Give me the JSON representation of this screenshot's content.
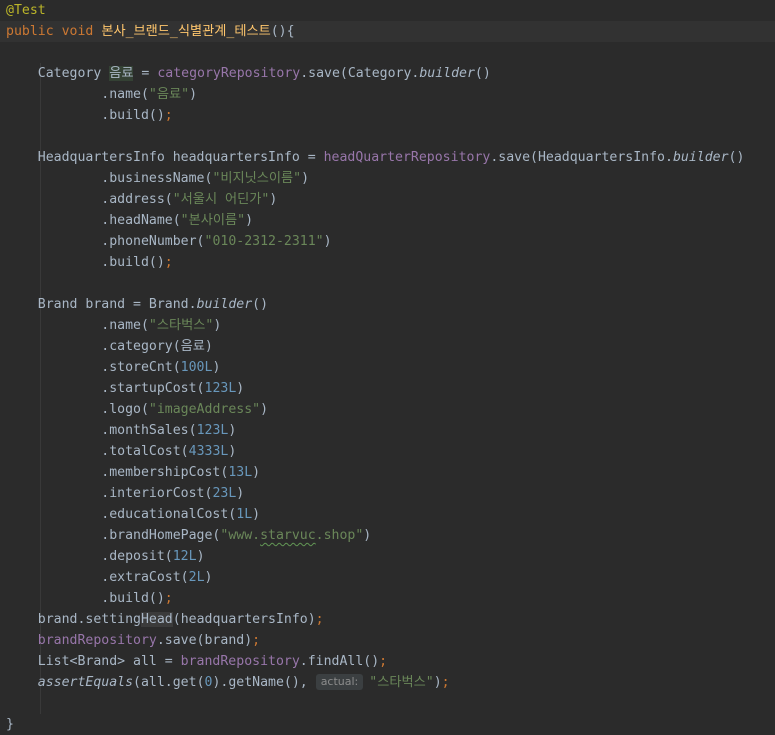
{
  "editor": {
    "lines": [
      [
        {
          "t": "@Test",
          "c": "ann"
        }
      ],
      [
        {
          "t": "public",
          "c": "kw"
        },
        {
          "t": " "
        },
        {
          "t": "void",
          "c": "kw"
        },
        {
          "t": " "
        },
        {
          "t": "본사_브랜드_식별관계_테스트",
          "c": "fn"
        },
        {
          "t": "(){"
        }
      ],
      [],
      [
        {
          "t": "    Category "
        },
        {
          "t": "음료",
          "c": "var-hl"
        },
        {
          "t": " = "
        },
        {
          "t": "categoryRepository",
          "c": "field"
        },
        {
          "t": ".save(Category."
        },
        {
          "t": "builder",
          "c": "it"
        },
        {
          "t": "()"
        }
      ],
      [
        {
          "t": "            .name("
        },
        {
          "t": "\"음료\"",
          "c": "str"
        },
        {
          "t": ")"
        }
      ],
      [
        {
          "t": "            .build()"
        },
        {
          "t": ";",
          "c": "kw"
        }
      ],
      [],
      [
        {
          "t": "    HeadquartersInfo headquartersInfo = "
        },
        {
          "t": "headQuarterRepository",
          "c": "field"
        },
        {
          "t": ".save(HeadquartersInfo."
        },
        {
          "t": "builder",
          "c": "it"
        },
        {
          "t": "()"
        }
      ],
      [
        {
          "t": "            .businessName("
        },
        {
          "t": "\"비지닛스이름\"",
          "c": "str"
        },
        {
          "t": ")"
        }
      ],
      [
        {
          "t": "            .address("
        },
        {
          "t": "\"서울시 어딘가\"",
          "c": "str"
        },
        {
          "t": ")"
        }
      ],
      [
        {
          "t": "            .headName("
        },
        {
          "t": "\"본사이름\"",
          "c": "str"
        },
        {
          "t": ")"
        }
      ],
      [
        {
          "t": "            .phoneNumber("
        },
        {
          "t": "\"010-2312-2311\"",
          "c": "str"
        },
        {
          "t": ")"
        }
      ],
      [
        {
          "t": "            .build()"
        },
        {
          "t": ";",
          "c": "kw"
        }
      ],
      [],
      [
        {
          "t": "    Brand brand = Brand."
        },
        {
          "t": "builder",
          "c": "it"
        },
        {
          "t": "()"
        }
      ],
      [
        {
          "t": "            .name("
        },
        {
          "t": "\"스타벅스\"",
          "c": "str"
        },
        {
          "t": ")"
        }
      ],
      [
        {
          "t": "            .category(음료)"
        }
      ],
      [
        {
          "t": "            .storeCnt("
        },
        {
          "t": "100L",
          "c": "num"
        },
        {
          "t": ")"
        }
      ],
      [
        {
          "t": "            .startupCost("
        },
        {
          "t": "123L",
          "c": "num"
        },
        {
          "t": ")"
        }
      ],
      [
        {
          "t": "            .logo("
        },
        {
          "t": "\"imageAddress\"",
          "c": "str"
        },
        {
          "t": ")"
        }
      ],
      [
        {
          "t": "            .monthSales("
        },
        {
          "t": "123L",
          "c": "num"
        },
        {
          "t": ")"
        }
      ],
      [
        {
          "t": "            .totalCost("
        },
        {
          "t": "4333L",
          "c": "num"
        },
        {
          "t": ")"
        }
      ],
      [
        {
          "t": "            .membershipCost("
        },
        {
          "t": "13L",
          "c": "num"
        },
        {
          "t": ")"
        }
      ],
      [
        {
          "t": "            .interiorCost("
        },
        {
          "t": "23L",
          "c": "num"
        },
        {
          "t": ")"
        }
      ],
      [
        {
          "t": "            .educationalCost("
        },
        {
          "t": "1L",
          "c": "num"
        },
        {
          "t": ")"
        }
      ],
      [
        {
          "t": "            .brandHomePage("
        },
        {
          "t": "\"www.",
          "c": "str"
        },
        {
          "t": "starvuc",
          "c": "str typo"
        },
        {
          "t": ".shop\"",
          "c": "str"
        },
        {
          "t": ")"
        }
      ],
      [
        {
          "t": "            .deposit("
        },
        {
          "t": "12L",
          "c": "num"
        },
        {
          "t": ")"
        }
      ],
      [
        {
          "t": "            .extraCost("
        },
        {
          "t": "2L",
          "c": "num"
        },
        {
          "t": ")"
        }
      ],
      [
        {
          "t": "            .build()"
        },
        {
          "t": ";",
          "c": "kw"
        }
      ],
      [
        {
          "t": "    brand.setting"
        },
        {
          "t": "Head",
          "c": "method-hl"
        },
        {
          "t": "(headquartersInfo)"
        },
        {
          "t": ";",
          "c": "kw"
        }
      ],
      [
        {
          "t": "    "
        },
        {
          "t": "brandRepository",
          "c": "field"
        },
        {
          "t": ".save(brand)"
        },
        {
          "t": ";",
          "c": "kw"
        }
      ],
      [
        {
          "t": "    List<Brand> all = "
        },
        {
          "t": "brandRepository",
          "c": "field"
        },
        {
          "t": ".findAll()"
        },
        {
          "t": ";",
          "c": "kw"
        }
      ],
      [
        {
          "t": "    "
        },
        {
          "t": "assertEquals",
          "c": "it"
        },
        {
          "t": "(all.get("
        },
        {
          "t": "0",
          "c": "num"
        },
        {
          "t": ").getName(), "
        },
        {
          "t": "actual:",
          "c": "hint"
        },
        {
          "t": "\"스타벅스\"",
          "c": "str"
        },
        {
          "t": ")"
        },
        {
          "t": ";",
          "c": "kw"
        }
      ],
      [],
      [
        {
          "t": "}"
        }
      ]
    ]
  }
}
